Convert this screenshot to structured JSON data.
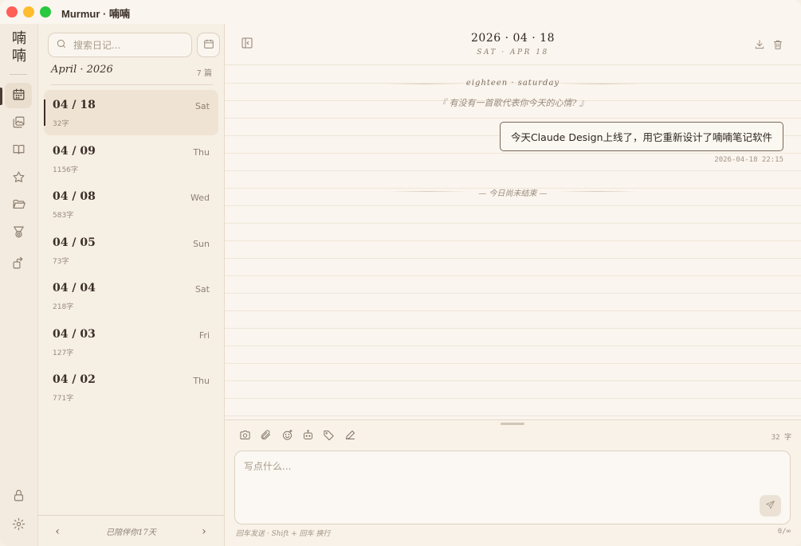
{
  "window": {
    "title": "Murmur · 喃喃"
  },
  "rail": {
    "logo": "喃\n喃",
    "items": [
      {
        "name": "calendar-icon",
        "active": true
      },
      {
        "name": "gallery-icon",
        "active": false
      },
      {
        "name": "book-icon",
        "active": false
      },
      {
        "name": "star-icon",
        "active": false
      },
      {
        "name": "folder-icon",
        "active": false
      },
      {
        "name": "medal-icon",
        "active": false
      },
      {
        "name": "share-icon",
        "active": false
      }
    ],
    "bottom": [
      "lock-icon",
      "gear-icon"
    ]
  },
  "list": {
    "search_placeholder": "搜索日记...",
    "month_title": "April · 2026",
    "month_count": "7 篇",
    "entries": [
      {
        "date": "04 / 18",
        "dow": "Sat",
        "words": "32字"
      },
      {
        "date": "04 / 09",
        "dow": "Thu",
        "words": "1156字"
      },
      {
        "date": "04 / 08",
        "dow": "Wed",
        "words": "583字"
      },
      {
        "date": "04 / 05",
        "dow": "Sun",
        "words": "73字"
      },
      {
        "date": "04 / 04",
        "dow": "Sat",
        "words": "218字"
      },
      {
        "date": "04 / 03",
        "dow": "Fri",
        "words": "127字"
      },
      {
        "date": "04 / 02",
        "dow": "Thu",
        "words": "771字"
      }
    ],
    "footer": {
      "companion": "已陪伴你17天",
      "prev": "‹",
      "next": "›"
    }
  },
  "main": {
    "header": {
      "date": "2026 · 04 · 18",
      "sub": "SAT · APR 18"
    },
    "day_label": "eighteen · saturday",
    "prompt": "『 有没有一首歌代表你今天的心情? 』",
    "message": {
      "text": "今天Claude Design上线了，用它重新设计了喃喃笔记软件",
      "time": "2026-04-18 22:15"
    },
    "end_label": "— 今日尚未结束 —"
  },
  "composer": {
    "tools": [
      "camera-icon",
      "paperclip-icon",
      "emoji-icon",
      "robot-icon",
      "tag-icon",
      "pen-icon"
    ],
    "word_count": "32 字",
    "placeholder": "写点什么...",
    "hint": "回车发送 · Shift + 回车 换行",
    "limit": "0/∞"
  },
  "colors": {
    "accent": "#3a2f28",
    "background": "#faf5ee",
    "sidebar": "#f6efe4"
  }
}
